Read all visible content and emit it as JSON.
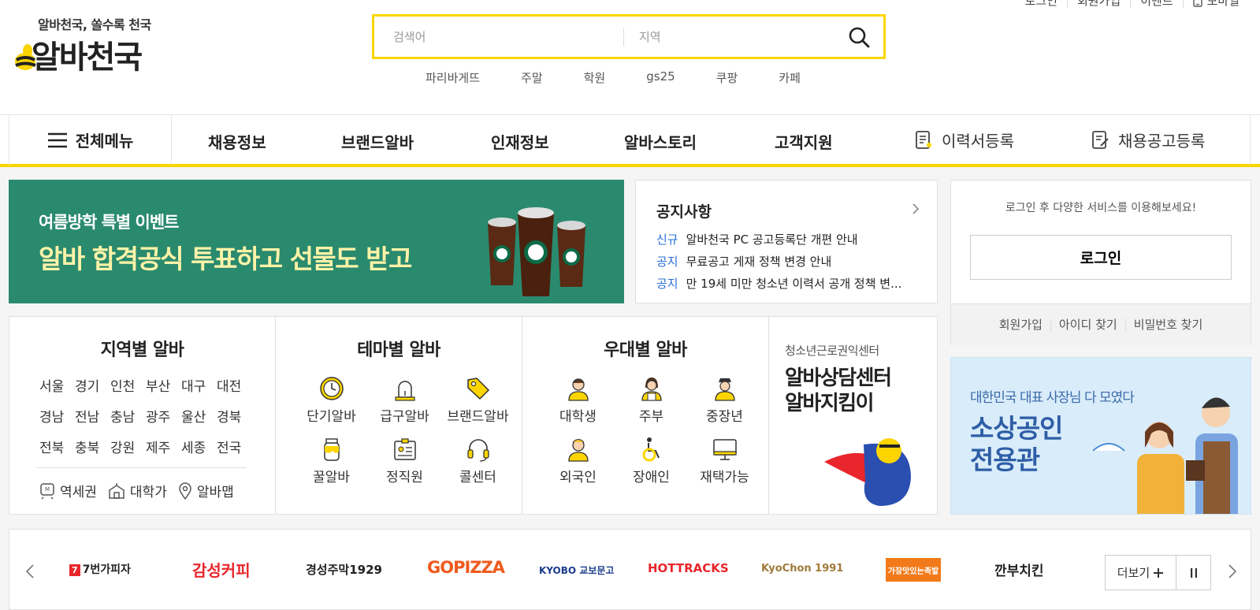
{
  "header": {
    "logo_tagline": "알바천국, 쏠수록 천국",
    "logo_text": "알바천국",
    "util_links": [
      "로그인",
      "회원가입",
      "이벤트",
      "모바일"
    ],
    "search": {
      "keyword_placeholder": "검색어",
      "location_placeholder": "지역"
    },
    "popular_keywords": [
      "파리바게뜨",
      "주말",
      "학원",
      "gs25",
      "쿠팡",
      "카페"
    ]
  },
  "nav": {
    "all_menu": "전체메뉴",
    "items": [
      "채용정보",
      "브랜드알바",
      "인재정보",
      "알바스토리",
      "고객지원"
    ],
    "resume_register": "이력서등록",
    "job_post_register": "채용공고등록"
  },
  "banner": {
    "subtitle": "여름방학 특별 이벤트",
    "title": "알바 합격공식 투표하고 선물도 받고",
    "bg_color": "#2a8a6e"
  },
  "notice": {
    "title": "공지사항",
    "items": [
      {
        "tag": "신규",
        "text": "알바천국 PC 공고등록단 개편 안내"
      },
      {
        "tag": "공지",
        "text": "무료공고 게재 정책 변경 안내"
      },
      {
        "tag": "공지",
        "text": "만 19세 미만 청소년 이력서 공개 정책 변..."
      }
    ]
  },
  "login": {
    "message": "로그인 후 다양한 서비스를 이용해보세요!",
    "button": "로그인",
    "links": [
      "회원가입",
      "아이디 찾기",
      "비밀번호 찾기"
    ]
  },
  "region": {
    "title": "지역별 알바",
    "regions": [
      "서울",
      "경기",
      "인천",
      "부산",
      "대구",
      "대전",
      "경남",
      "전남",
      "충남",
      "광주",
      "울산",
      "경북",
      "전북",
      "충북",
      "강원",
      "제주",
      "세종",
      "전국"
    ],
    "links": [
      "역세권",
      "대학가",
      "알바맵"
    ]
  },
  "theme": {
    "title": "테마별 알바",
    "items": [
      "단기알바",
      "급구알바",
      "브랜드알바",
      "꿀알바",
      "정직원",
      "콜센터"
    ]
  },
  "benefit": {
    "title": "우대별 알바",
    "items": [
      "대학생",
      "주부",
      "중장년",
      "외국인",
      "장애인",
      "재택가능"
    ]
  },
  "help_center": {
    "org": "청소년근로권익센터",
    "title_line1": "알바상담센터",
    "title_line2": "알바지킴이"
  },
  "sijang_banner": {
    "subtitle": "대한민국 대표 사장님 다 모였다",
    "title_line1": "소상공인",
    "title_line2": "전용관"
  },
  "brands": {
    "items": [
      "7번가피자",
      "감성커피",
      "경성주막1929",
      "GOPIZZA",
      "KYOBO 교보문고",
      "HOTTRACKS",
      "KyoChon 1991",
      "가장맛있는족발",
      "깐부치킨"
    ],
    "more_label": "더보기"
  },
  "colors": {
    "accent": "#fcd500",
    "notice_tag": "#2b6fd6"
  }
}
